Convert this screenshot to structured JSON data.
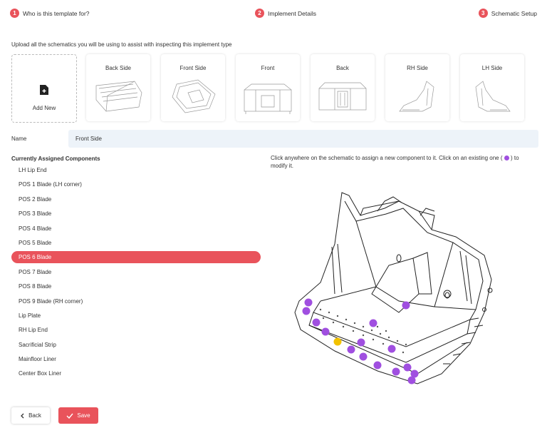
{
  "steps": [
    {
      "number": "1",
      "label": "Who is this template for?"
    },
    {
      "number": "2",
      "label": "Implement Details"
    },
    {
      "number": "3",
      "label": "Schematic Setup"
    }
  ],
  "instructions": "Upload all the schematics you will be using to assist with inspecting this implement type",
  "add_new_label": "Add New",
  "schematics": [
    "Back Side",
    "Front Side",
    "Front",
    "Back",
    "RH Side",
    "LH Side"
  ],
  "name": {
    "label": "Name",
    "value": "Front Side"
  },
  "components": {
    "title": "Currently Assigned Components",
    "selected_index": 6,
    "items": [
      "LH Lip End",
      "POS 1 Blade (LH corner)",
      "POS 2 Blade",
      "POS 3 Blade",
      "POS 4 Blade",
      "POS 5 Blade",
      "POS 6 Blade",
      "POS 7 Blade",
      "POS 8 Blade",
      "POS 9 Blade (RH corner)",
      "Lip Plate",
      "RH Lip End",
      "Sacrificial Strip",
      "Mainfloor Liner",
      "Center Box Liner"
    ]
  },
  "hint": {
    "before": "Click anywhere on the schematic to assign a new component to it. Click on an existing one (",
    "after": ") to modify it."
  },
  "colors": {
    "accent": "#e9535b",
    "marker": "#a04fe0",
    "marker_selected": "#f2c200",
    "field_bg": "#edf3f9"
  },
  "buttons": {
    "back": "Back",
    "save": "Save"
  }
}
